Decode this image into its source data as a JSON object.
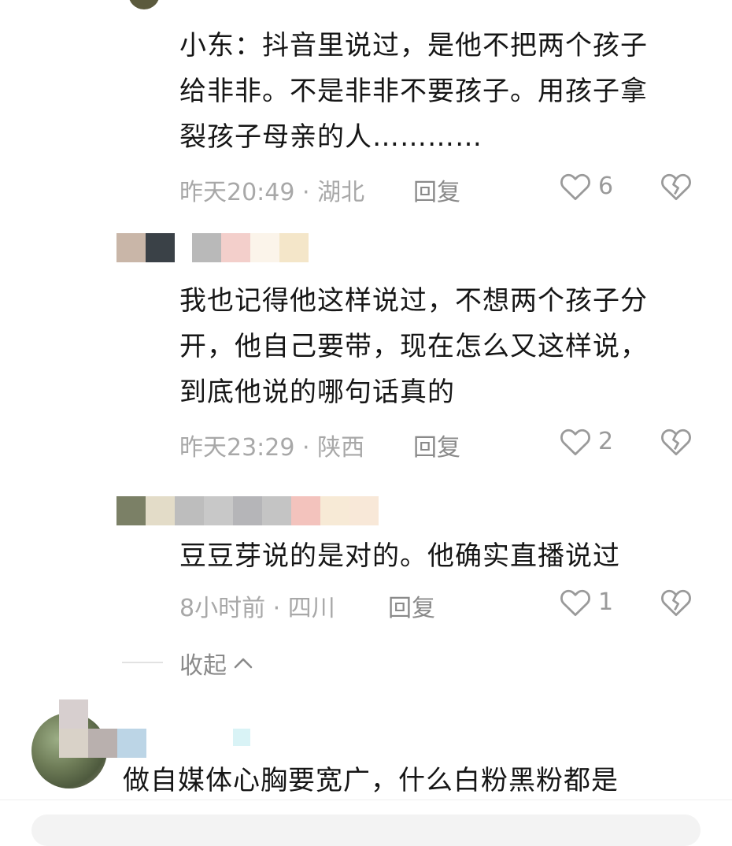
{
  "comments": [
    {
      "text_lines": [
        "小东：抖音里说过，是他不把两个孩子",
        "给非非。不是非非不要孩子。用孩子拿",
        "裂孩子母亲的人…………"
      ],
      "time": "昨天20:49",
      "location": "湖北",
      "reply_label": "回复",
      "likes": "6"
    },
    {
      "text_lines": [
        "我也记得他这样说过，不想两个孩子分",
        "开，他自己要带，现在怎么又这样说，",
        "到底他说的哪句话真的"
      ],
      "time": "昨天23:29",
      "location": "陕西",
      "reply_label": "回复",
      "likes": "2"
    },
    {
      "text_lines": [
        "豆豆芽说的是对的。他确实直播说过"
      ],
      "time": "8小时前",
      "location": "四川",
      "reply_label": "回复",
      "likes": "1"
    }
  ],
  "collapse_label": "收起",
  "next_comment": {
    "text": "做自媒体心胸要宽广，什么白粉黑粉都是"
  },
  "colors": {
    "meta_gray": "#a8a8a8",
    "text": "#161616",
    "like_icon": "#9a9a9a"
  }
}
